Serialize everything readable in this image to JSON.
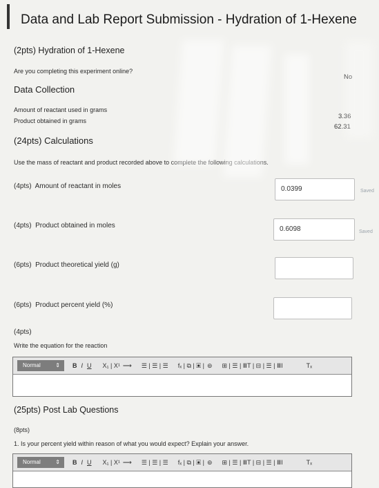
{
  "header": {
    "title": "Data and Lab Report Submission - Hydration of 1-Hexene"
  },
  "section1": {
    "heading": "(2pts) Hydration of 1-Hexene",
    "question": "Are you completing this experiment online?",
    "answer": "No"
  },
  "data_collection": {
    "heading": "Data Collection",
    "rows": [
      {
        "label": "Amount of reactant used in grams",
        "value": "3.36"
      },
      {
        "label": "Product obtained in grams",
        "value": "62.31"
      }
    ]
  },
  "calculations": {
    "heading": "(24pts) Calculations",
    "instructions": "Use the mass of reactant and product recorded above to complete the following calculations.",
    "items": [
      {
        "pts": "(4pts)",
        "label": "Amount of reactant in moles",
        "value": "0.0399",
        "status": "Saved"
      },
      {
        "pts": "(4pts)",
        "label": "Product obtained in moles",
        "value": "0.6098",
        "status": "Saved"
      },
      {
        "pts": "(6pts)",
        "label": "Product theoretical yield (g)",
        "value": "",
        "status": ""
      },
      {
        "pts": "(6pts)",
        "label": "Product percent yield (%)",
        "value": "",
        "status": ""
      }
    ],
    "equation_pts": "(4pts)",
    "equation_prompt": "Write the equation for the reaction"
  },
  "toolbar": {
    "format": "Normal",
    "format_arrow": "⇕",
    "bold": "B",
    "italic": "I",
    "underline": "U",
    "subsup": "X₁ | X¹",
    "arrow": "⟶",
    "lists": "☰ | ☰ | ☰",
    "fx": "fₓ | ⧉ | ▣ |",
    "link": "⊚",
    "table": "⊞ | ☰ | ⅢT | ⊟ | ☰ | ⅢI",
    "clear": "Tₓ"
  },
  "post_lab": {
    "heading": "(25pts) Post Lab Questions",
    "pts": "(8pts)",
    "question": "1. Is your percent yield within reason of what you would expect? Explain your answer."
  }
}
